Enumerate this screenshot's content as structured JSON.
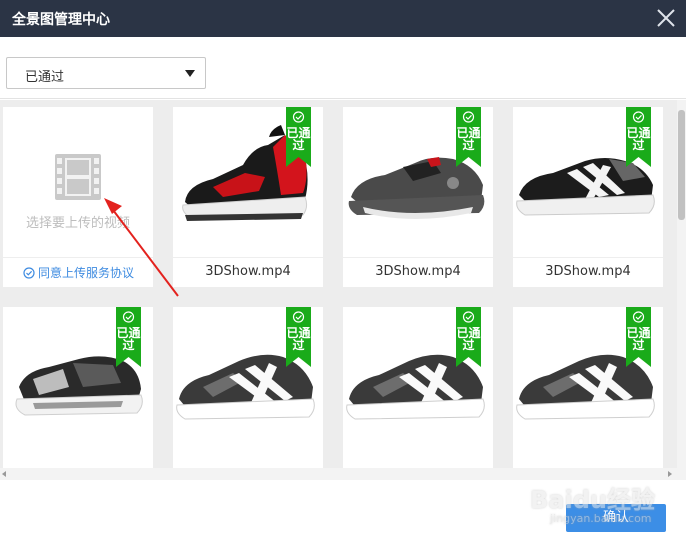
{
  "window": {
    "title": "全景图管理中心"
  },
  "filter": {
    "selected": "已通过"
  },
  "upload_card": {
    "hint": "选择要上传的视频",
    "agreement": "同意上传服务协议"
  },
  "badge_text": "已通过",
  "cards": [
    {
      "file_name": "3DShow.mp4",
      "status": "已通过"
    },
    {
      "file_name": "3DShow.mp4",
      "status": "已通过"
    },
    {
      "file_name": "3DShow.mp4",
      "status": "已通过"
    },
    {
      "file_name": "",
      "status": "已通过"
    },
    {
      "file_name": "",
      "status": "已通过"
    },
    {
      "file_name": "",
      "status": "已通过"
    },
    {
      "file_name": "",
      "status": "已通过"
    }
  ],
  "footer": {
    "confirm_label": "确认"
  },
  "watermark": {
    "brand": "Baidu经验",
    "url": "jingyan.baidu.com"
  },
  "colors": {
    "titlebar": "#2b3445",
    "badge": "#1aab1a",
    "confirm": "#3c8ee6",
    "link": "#3e8be0"
  }
}
